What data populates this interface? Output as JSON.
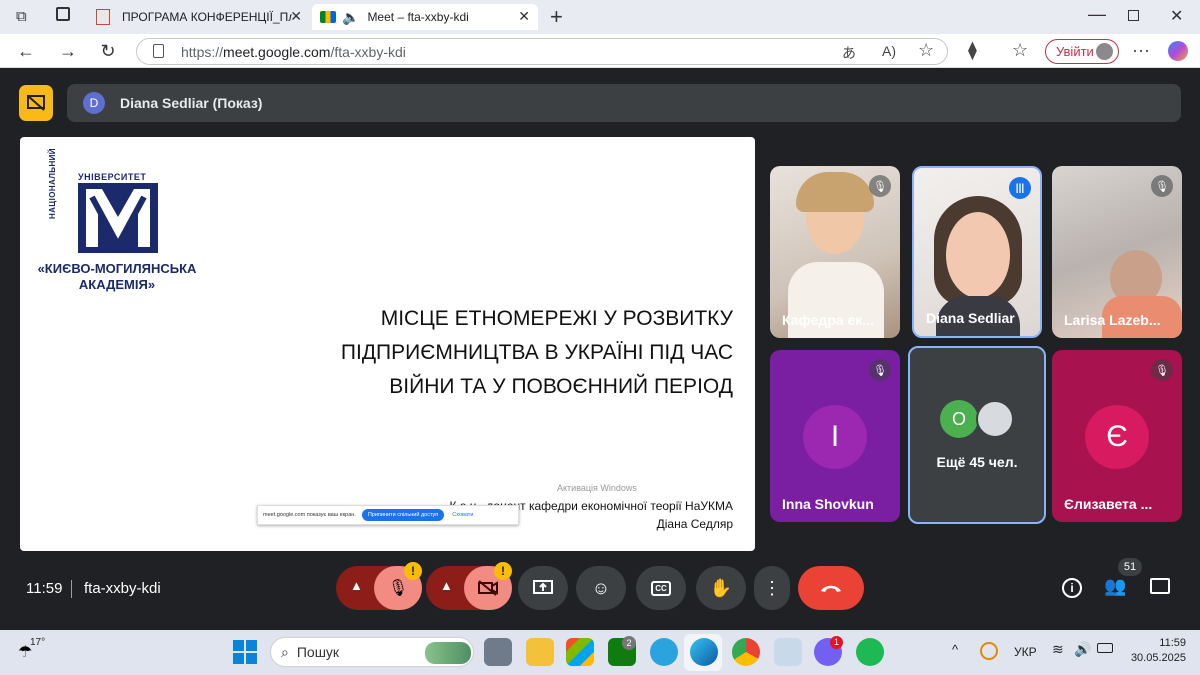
{
  "browser": {
    "tabs": [
      {
        "title": "ПРОГРАМА КОНФЕРЕНЦІЇ_Плен",
        "active": false
      },
      {
        "title": "Meet – fta-xxby-kdi",
        "active": true
      }
    ],
    "url_prefix": "https://",
    "url_host": "meet.google.com",
    "url_path": "/fta-xxby-kdi",
    "signin_label": "Увійти"
  },
  "meet": {
    "presenter_initial": "D",
    "presenter_label": "Diana Sedliar (Показ)",
    "slide": {
      "logo_top": "УНІВЕРСИТЕТ",
      "logo_side": "НАЦІОНАЛЬНИЙ",
      "logo_line1": "«КИЄВО-МОГИЛЯНСЬКА",
      "logo_line2": "АКАДЕМІЯ»",
      "title_lines": [
        "МІСЦЕ ЕТНОМЕРЕЖІ У РОЗВИТКУ",
        "ПІДПРИЄМНИЦТВА В УКРАЇНІ ПІД ЧАС",
        "ВІЙНИ ТА У ПОВОЄННИЙ ПЕРІОД"
      ],
      "watermark": "Активація Windows",
      "author_line1": "К.е.н., доцент кафедри економічної теорії НаУКМА",
      "author_line2": "Діана Седляр",
      "share_notice": "meet.google.com показує ваш екран.",
      "share_stop": "Припинити спільний доступ",
      "share_hide": "Сховати"
    },
    "tiles": [
      {
        "name": "Кафедра ек...",
        "muted": true
      },
      {
        "name": "Diana Sedliar",
        "muted": false
      },
      {
        "name": "Larisa Lazeb...",
        "muted": true
      },
      {
        "name": "Inna Shovkun",
        "letter": "I",
        "muted": true,
        "color": "#7b1fa2"
      },
      {
        "name": "Ещё 45 чел.",
        "letter": "О",
        "muted": false,
        "color": "#3c4043"
      },
      {
        "name": "Єлизавета ...",
        "letter": "Є",
        "muted": true,
        "color": "#c2185b"
      }
    ],
    "clock": "11:59",
    "meeting_code": "fta-xxby-kdi",
    "participants_count": "51"
  },
  "taskbar": {
    "weather": "17°",
    "search_placeholder": "Пошук",
    "teams_badge": "2",
    "viber_badge": "1",
    "lang": "УКР",
    "time": "11:59",
    "date": "30.05.2025"
  }
}
